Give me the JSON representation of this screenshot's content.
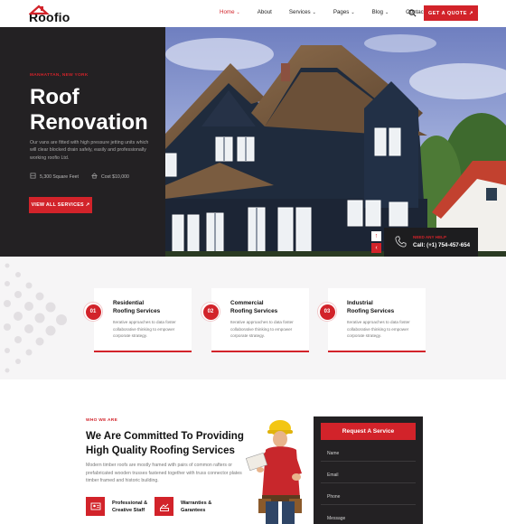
{
  "brand": {
    "name": "Roofio",
    "accent": "#d2232a",
    "dark": "#232123"
  },
  "nav": {
    "items": [
      {
        "label": "Home",
        "caret": true,
        "active": true
      },
      {
        "label": "About",
        "caret": false,
        "active": false
      },
      {
        "label": "Services",
        "caret": true,
        "active": false
      },
      {
        "label": "Pages",
        "caret": true,
        "active": false
      },
      {
        "label": "Blog",
        "caret": true,
        "active": false
      },
      {
        "label": "Contact",
        "caret": true,
        "active": false
      }
    ],
    "cta": "GET A QUOTE ↗",
    "search_icon": "search-icon"
  },
  "hero": {
    "eyebrow": "MANHATTAN, NEW YORK",
    "title_line1": "Roof",
    "title_line2": "Renovation",
    "description": "Our vans are fitted with high pressure jetting units which will clear blocked drain safely, easily and professionally working roofio Ltd.",
    "meta_area": "5,300 Square Feet",
    "meta_cost": "Cost $10,000",
    "button": "VIEW ALL SERVICES ↗",
    "help_label": "NEED ANY HELP",
    "help_phone": "Call: (+1) 754-457-654"
  },
  "services": [
    {
      "num": "01",
      "title_line1": "Residential",
      "title_line2": "Roofing Services",
      "desc": "Iterative approaches to data foster collaborative thinking to empower corporate strategy."
    },
    {
      "num": "02",
      "title_line1": "Commercial",
      "title_line2": "Roofing Services",
      "desc": "Iterative approaches to data foster collaborative thinking to empower corporate strategy."
    },
    {
      "num": "03",
      "title_line1": "Industrial",
      "title_line2": "Roofing Services",
      "desc": "Iterative approaches to data foster collaborative thinking to empower corporate strategy."
    }
  ],
  "about": {
    "eyebrow": "WHO WE ARE",
    "title": "We Are Committed To Providing High Quality Roofing Services",
    "description": "Modern timber roofs are mostly framed with pairs of common rafters or prefabricated wooden trusses fastened together with truss connector plates timber framed and historic building.",
    "features": [
      {
        "label": "Professional & Creative Staff",
        "icon": "staff-icon"
      },
      {
        "label": "Warranties & Garantees",
        "icon": "warranty-icon"
      }
    ]
  },
  "request_form": {
    "title": "Request A Service",
    "fields": [
      "Name",
      "Email",
      "Phone",
      "Message"
    ]
  }
}
